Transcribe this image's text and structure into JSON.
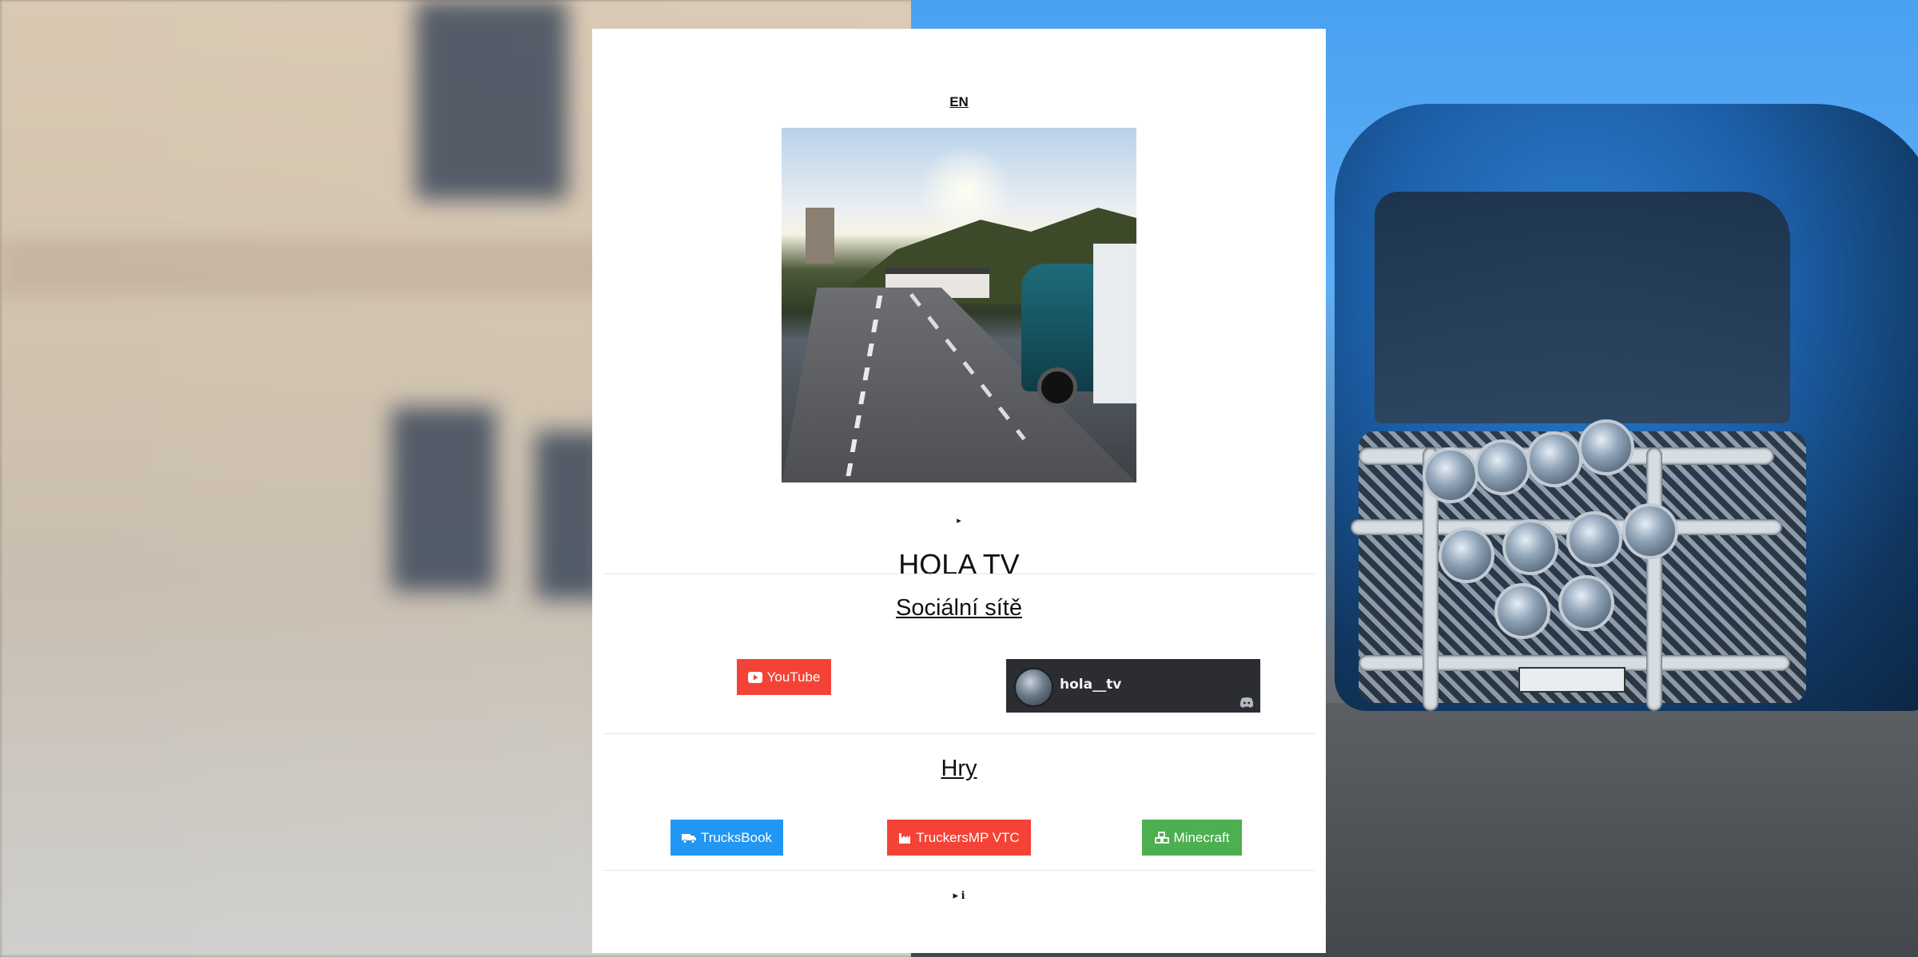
{
  "language_toggle": "EN",
  "media": {
    "play_marker": "▸"
  },
  "channel": {
    "name": "HOLA TV"
  },
  "social": {
    "heading": "Sociální sítě",
    "youtube_label": "YouTube",
    "discord": {
      "username": "hola__tv"
    }
  },
  "games": {
    "heading": "Hry",
    "trucksbook_label": "TrucksBook",
    "truckersmp_label": "TruckersMP VTC",
    "minecraft_label": "Minecraft"
  },
  "footer": {
    "info_toggle": "▸ ℹ"
  },
  "colors": {
    "youtube_red": "#f44336",
    "trucksbook_blue": "#2196f3",
    "minecraft_green": "#4caf50",
    "discord_dark": "#2b2d31"
  },
  "icons": {
    "youtube": "youtube-icon",
    "trucksbook": "truck-icon",
    "truckersmp": "industry-icon",
    "minecraft": "cubes-icon",
    "discord": "discord-icon"
  }
}
